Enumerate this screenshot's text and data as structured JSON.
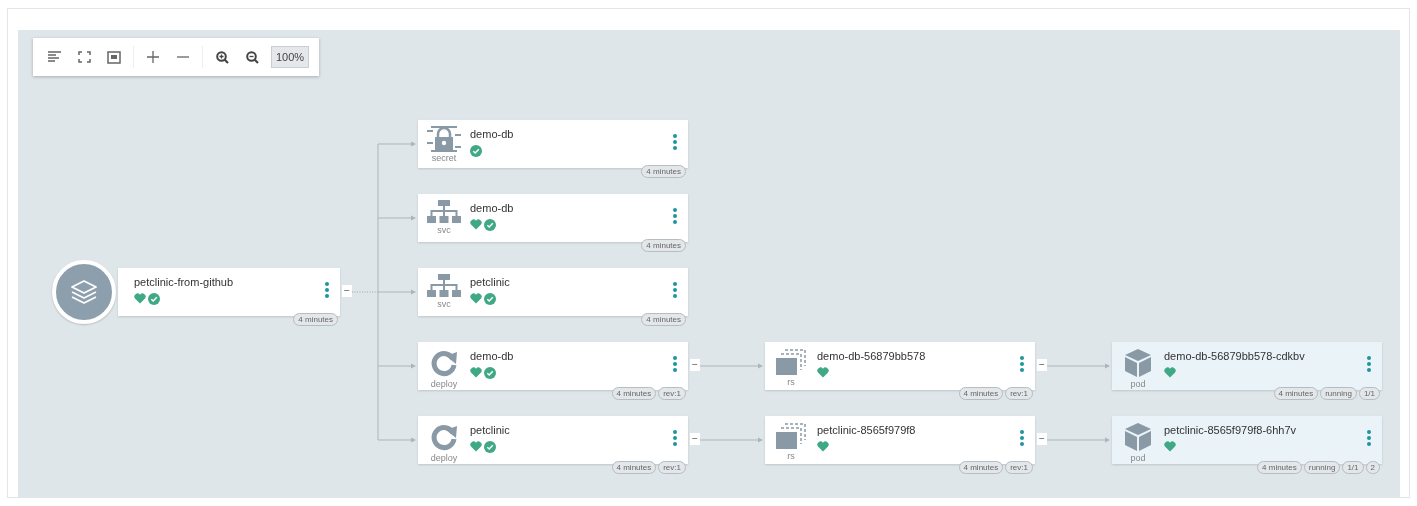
{
  "toolbar": {
    "zoom_label": "100%"
  },
  "topology": {
    "root": {
      "kind": "app",
      "name": "petclinic-from-github",
      "healthy": true,
      "ready": true,
      "badges": [
        "4 minutes"
      ],
      "toggle": "−",
      "children": [
        {
          "kind": "secret",
          "type_label": "secret",
          "name": "demo-db",
          "healthy": false,
          "ready": true,
          "badges": [
            "4 minutes"
          ]
        },
        {
          "kind": "svc",
          "type_label": "svc",
          "name": "demo-db",
          "healthy": true,
          "ready": true,
          "badges": [
            "4 minutes"
          ]
        },
        {
          "kind": "svc",
          "type_label": "svc",
          "name": "petclinic",
          "healthy": true,
          "ready": true,
          "badges": [
            "4 minutes"
          ]
        },
        {
          "kind": "deploy",
          "type_label": "deploy",
          "name": "demo-db",
          "healthy": true,
          "ready": true,
          "badges": [
            "4 minutes",
            "rev:1"
          ],
          "toggle": "−",
          "children": [
            {
              "kind": "rs",
              "type_label": "rs",
              "name": "demo-db-56879bb578",
              "healthy": true,
              "ready": false,
              "badges": [
                "4 minutes",
                "rev:1"
              ],
              "toggle": "−",
              "children": [
                {
                  "kind": "pod",
                  "type_label": "pod",
                  "name": "demo-db-56879bb578-cdkbv",
                  "healthy": true,
                  "ready": false,
                  "badges": [
                    "4 minutes",
                    "running",
                    "1/1"
                  ]
                }
              ]
            }
          ]
        },
        {
          "kind": "deploy",
          "type_label": "deploy",
          "name": "petclinic",
          "healthy": true,
          "ready": true,
          "badges": [
            "4 minutes",
            "rev:1"
          ],
          "toggle": "−",
          "children": [
            {
              "kind": "rs",
              "type_label": "rs",
              "name": "petclinic-8565f979f8",
              "healthy": true,
              "ready": false,
              "badges": [
                "4 minutes",
                "rev:1"
              ],
              "toggle": "−",
              "children": [
                {
                  "kind": "pod",
                  "type_label": "pod",
                  "name": "petclinic-8565f979f8-6hh7v",
                  "healthy": true,
                  "ready": false,
                  "badges": [
                    "4 minutes",
                    "running",
                    "1/1",
                    "2"
                  ]
                }
              ]
            }
          ]
        }
      ]
    }
  }
}
